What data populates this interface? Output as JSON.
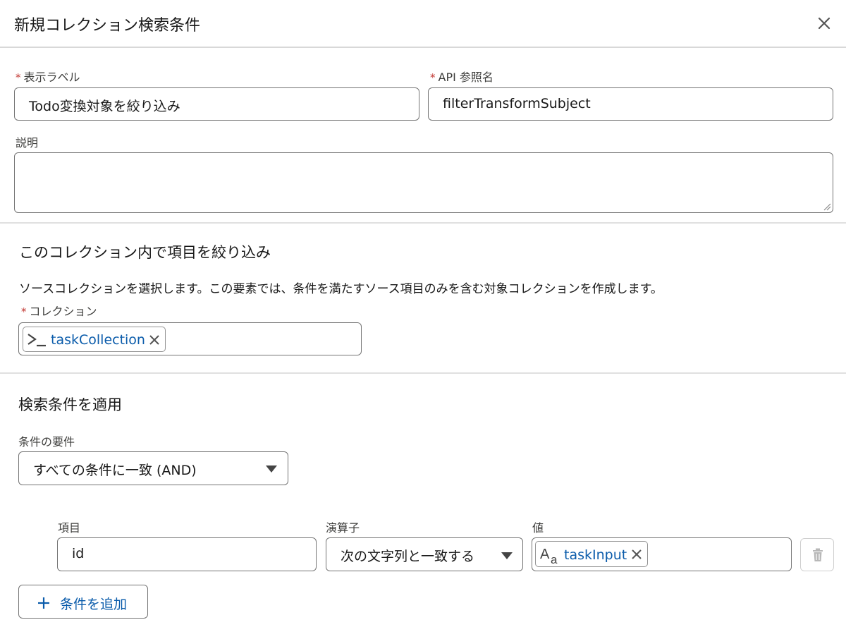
{
  "modal": {
    "title": "新規コレクション検索条件"
  },
  "fields": {
    "label": {
      "label": "表示ラベル",
      "required_mark": "*",
      "value": "Todo変換対象を絞り込み"
    },
    "api_name": {
      "label": "API 参照名",
      "required_mark": "*",
      "value": "filterTransformSubject"
    },
    "description": {
      "label": "説明",
      "value": ""
    }
  },
  "collection_section": {
    "title": "このコレクション内で項目を絞り込み",
    "description": "ソースコレクションを選択します。この要素では、条件を満たすソース項目のみを含む対象コレクションを作成します。",
    "collection_label": "コレクション",
    "required_mark": "*",
    "selected_collection": "taskCollection"
  },
  "filter_section": {
    "title": "検索条件を適用",
    "requirement_label": "条件の要件",
    "requirement_value": "すべての条件に一致 (AND)",
    "columns": {
      "field": "項目",
      "operator": "演算子",
      "value": "値"
    },
    "condition": {
      "field": "id",
      "operator": "次の文字列と一致する",
      "value": "taskInput"
    },
    "add_condition_label": "条件を追加"
  },
  "icons": {
    "close": "close-icon",
    "collection_resource": "terminal-icon",
    "text_resource": "text-variable-icon",
    "remove": "close-icon",
    "delete": "trash-icon",
    "add": "plus-icon",
    "dropdown": "chevron-down-icon"
  },
  "colors": {
    "link_blue": "#0b5cab",
    "required_red": "#c23934",
    "border": "#747474"
  }
}
